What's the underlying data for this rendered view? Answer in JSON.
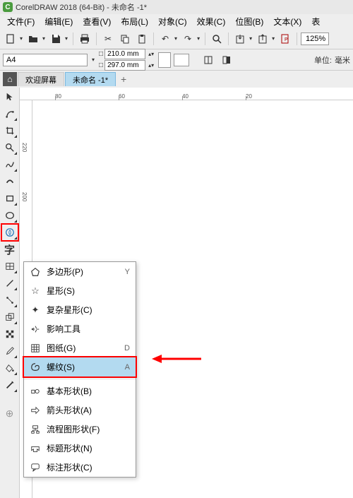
{
  "titlebar": {
    "app_icon": "C",
    "title": "CorelDRAW 2018 (64-Bit) - 未命名 -1*"
  },
  "menubar": {
    "items": [
      "文件(F)",
      "编辑(E)",
      "查看(V)",
      "布局(L)",
      "对象(C)",
      "效果(C)",
      "位图(B)",
      "文本(X)",
      "表"
    ]
  },
  "toolbar": {
    "zoom": "125%"
  },
  "props": {
    "paper": "A4",
    "width": "210.0 mm",
    "height": "297.0 mm",
    "unit_label": "单位:",
    "unit_value": "毫米"
  },
  "tabs": {
    "welcome": "欢迎屏幕",
    "doc": "未命名 -1*"
  },
  "ruler_h": [
    {
      "pos": 50,
      "label": "80"
    },
    {
      "pos": 140,
      "label": "60"
    },
    {
      "pos": 230,
      "label": "40"
    },
    {
      "pos": 320,
      "label": "20"
    }
  ],
  "ruler_v": [
    {
      "pos": 60,
      "label": "220"
    },
    {
      "pos": 130,
      "label": "200"
    }
  ],
  "flyout": {
    "items": [
      {
        "icon": "pentagon",
        "label": "多边形(P)",
        "shortcut": "Y"
      },
      {
        "icon": "star",
        "label": "星形(S)",
        "shortcut": ""
      },
      {
        "icon": "complex-star",
        "label": "复杂星形(C)",
        "shortcut": ""
      },
      {
        "icon": "impact",
        "label": "影响工具",
        "shortcut": ""
      },
      {
        "icon": "grid",
        "label": "图纸(G)",
        "shortcut": "D"
      },
      {
        "icon": "spiral",
        "label": "螺纹(S)",
        "shortcut": "A",
        "highlighted": true
      },
      {
        "sep": true
      },
      {
        "icon": "basic-shape",
        "label": "基本形状(B)",
        "shortcut": ""
      },
      {
        "icon": "arrow-shape",
        "label": "箭头形状(A)",
        "shortcut": ""
      },
      {
        "icon": "flowchart",
        "label": "流程图形状(F)",
        "shortcut": ""
      },
      {
        "icon": "banner",
        "label": "标题形状(N)",
        "shortcut": ""
      },
      {
        "icon": "callout",
        "label": "标注形状(C)",
        "shortcut": ""
      }
    ]
  }
}
